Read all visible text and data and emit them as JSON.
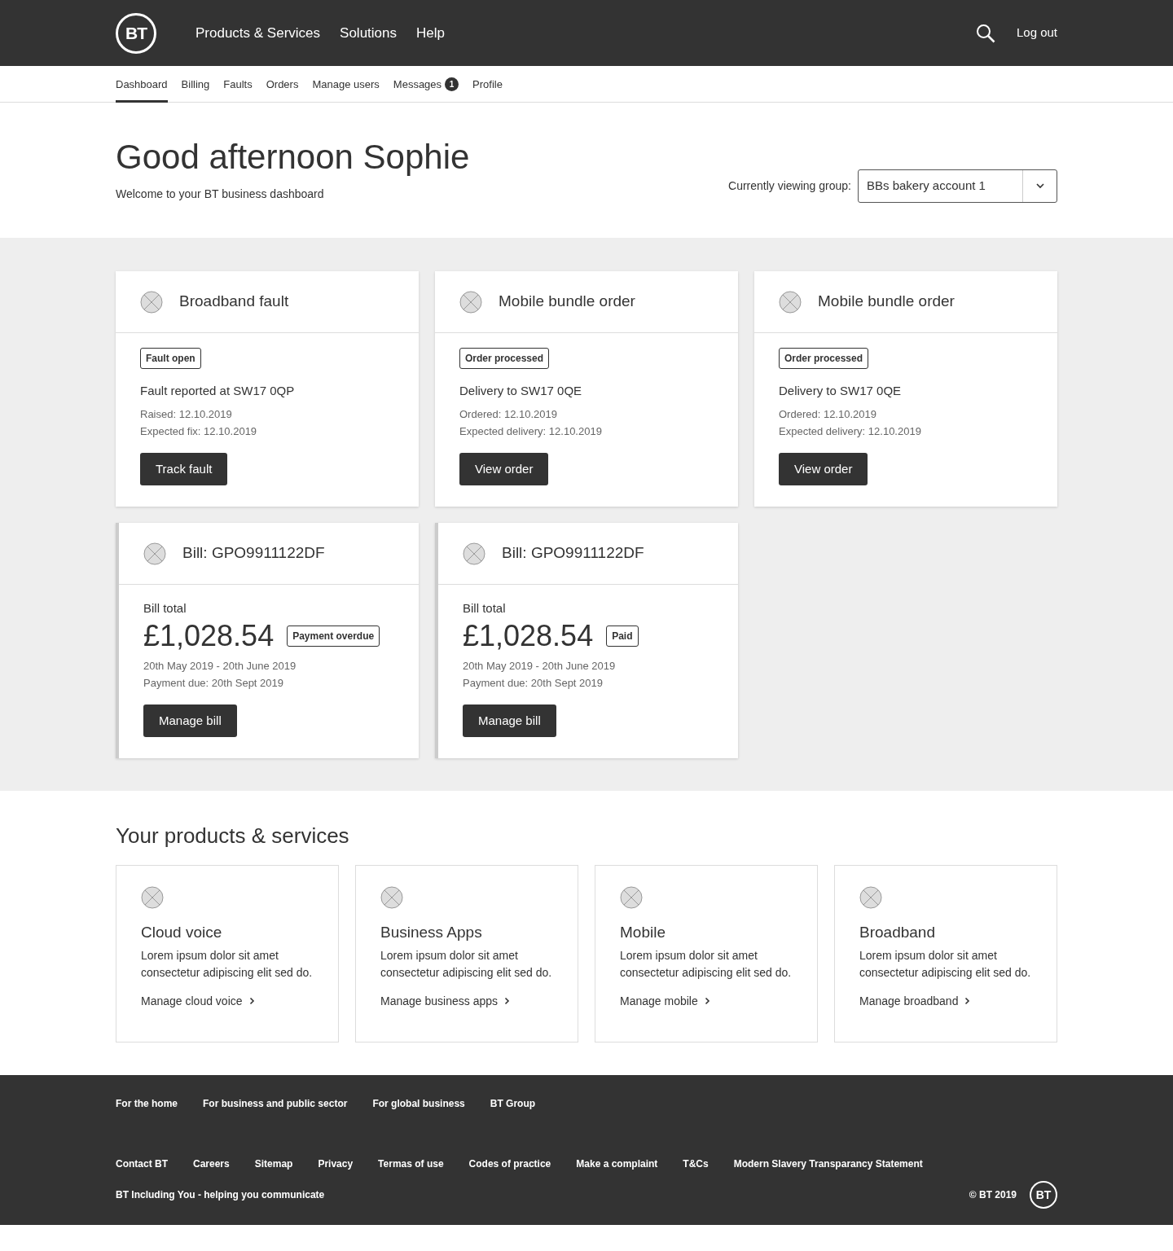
{
  "header": {
    "logo": "BT",
    "nav": [
      "Products & Services",
      "Solutions",
      "Help"
    ],
    "logout": "Log out"
  },
  "subnav": [
    {
      "label": "Dashboard",
      "selected": true
    },
    {
      "label": "Billing",
      "selected": false
    },
    {
      "label": "Faults",
      "selected": false
    },
    {
      "label": "Orders",
      "selected": false
    },
    {
      "label": "Manage users",
      "selected": false
    },
    {
      "label": "Messages",
      "selected": false,
      "badge": "1"
    },
    {
      "label": "Profile",
      "selected": false
    }
  ],
  "greeting": {
    "title": "Good afternoon Sophie",
    "subtitle": "Welcome to your BT business dashboard",
    "group_label": "Currently viewing group:",
    "group_value": "BBs bakery account 1"
  },
  "alerts": [
    {
      "kind": "status",
      "title": "Broadband fault",
      "tag": "Fault open",
      "headline": "Fault reported at SW17 0QP",
      "details": [
        "Raised: 12.10.2019",
        "Expected fix: 12.10.2019"
      ],
      "button": "Track fault"
    },
    {
      "kind": "status",
      "title": "Mobile bundle order",
      "tag": "Order processed",
      "headline": "Delivery to SW17 0QE",
      "details": [
        "Ordered: 12.10.2019",
        "Expected delivery: 12.10.2019"
      ],
      "button": "View order"
    },
    {
      "kind": "status",
      "title": "Mobile bundle order",
      "tag": "Order processed",
      "headline": "Delivery to SW17 0QE",
      "details": [
        "Ordered: 12.10.2019",
        "Expected delivery: 12.10.2019"
      ],
      "button": "View order"
    },
    {
      "kind": "bill",
      "title": "Bill: GPO9911122DF",
      "total_label": "Bill total",
      "amount": "£1,028.54",
      "tag": "Payment overdue",
      "details": [
        "20th May 2019 - 20th June 2019",
        "Payment due: 20th Sept 2019"
      ],
      "button": "Manage bill"
    },
    {
      "kind": "bill",
      "title": "Bill: GPO9911122DF",
      "total_label": "Bill total",
      "amount": "£1,028.54",
      "tag": "Paid",
      "details": [
        "20th May 2019 - 20th June 2019",
        "Payment due: 20th Sept 2019"
      ],
      "button": "Manage bill"
    }
  ],
  "products": {
    "title": "Your products & services",
    "items": [
      {
        "title": "Cloud voice",
        "text": "Lorem ipsum dolor sit amet consectetur adipiscing elit sed do.",
        "link": "Manage cloud voice"
      },
      {
        "title": "Business Apps",
        "text": "Lorem ipsum dolor sit amet consectetur adipiscing elit sed do.",
        "link": "Manage business apps"
      },
      {
        "title": "Mobile",
        "text": "Lorem ipsum dolor sit amet consectetur adipiscing elit sed do.",
        "link": "Manage mobile"
      },
      {
        "title": "Broadband",
        "text": "Lorem ipsum dolor sit amet consectetur adipiscing elit sed do.",
        "link": "Manage broadband"
      }
    ]
  },
  "footer": {
    "primary": [
      "For the home",
      "For business and public sector",
      "For global business",
      "BT Group"
    ],
    "secondary": [
      "Contact BT",
      "Careers",
      "Sitemap",
      "Privacy",
      "Termas of use",
      "Codes of practice",
      "Make a complaint",
      "T&Cs",
      "Modern Slavery Transparancy Statement"
    ],
    "tagline": "BT Including You - helping you communicate",
    "copyright": "© BT 2019",
    "logo": "BT"
  }
}
